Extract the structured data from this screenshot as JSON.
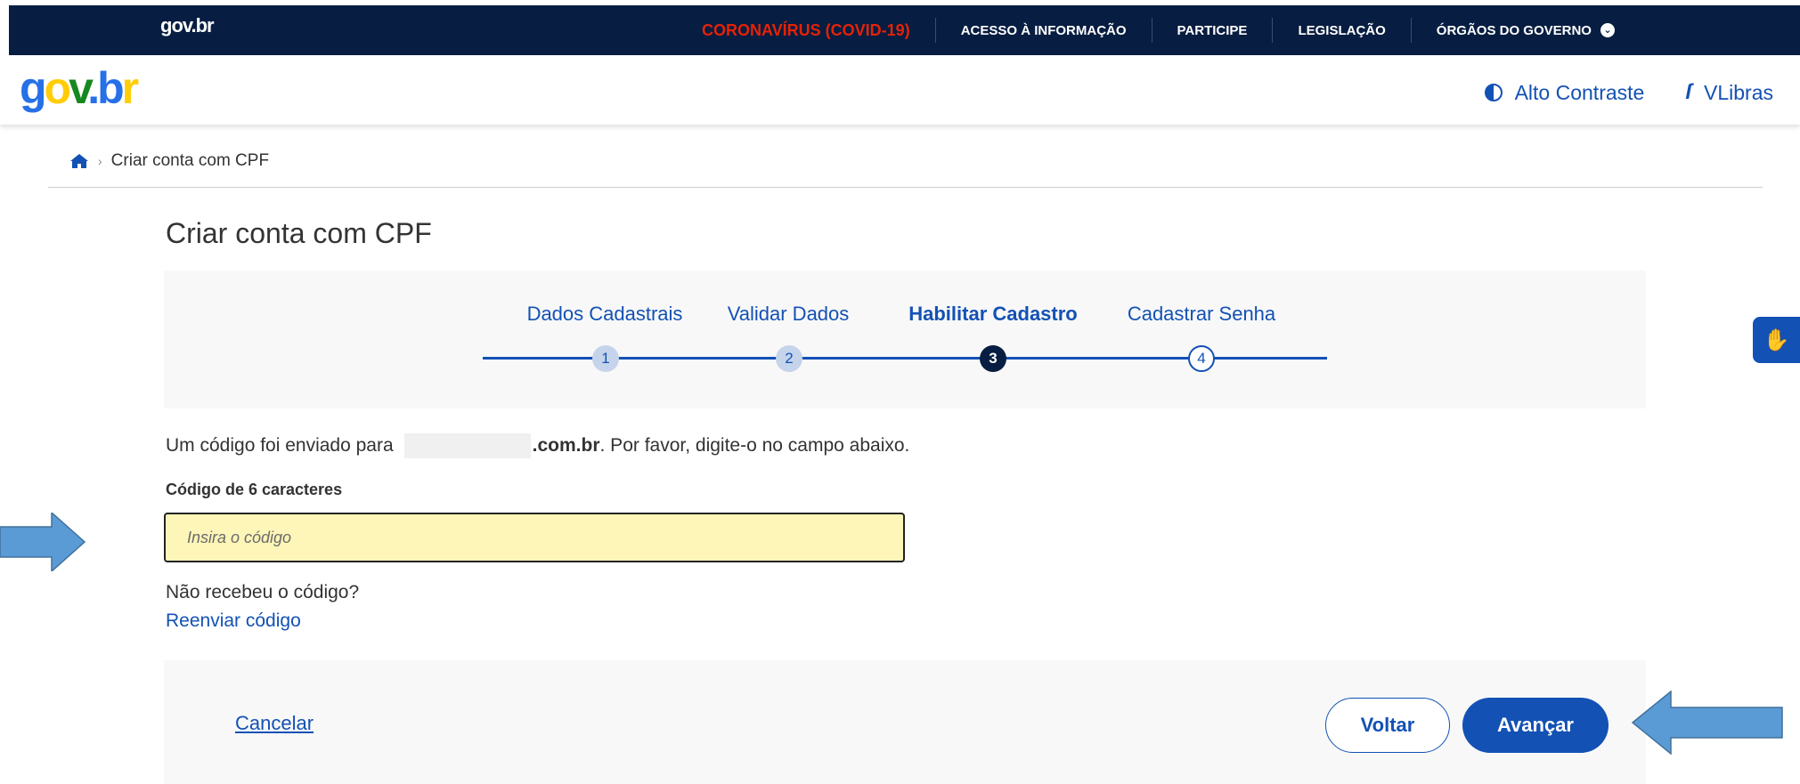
{
  "topbar": {
    "brand": "gov.br",
    "links": [
      {
        "label": "CORONAVÍRUS (COVID-19)"
      },
      {
        "label": "ACESSO À INFORMAÇÃO"
      },
      {
        "label": "PARTICIPE"
      },
      {
        "label": "LEGISLAÇÃO"
      },
      {
        "label": "ÓRGÃOS DO GOVERNO"
      }
    ],
    "colors": {
      "background": "#071d41",
      "covid": "#e52207"
    }
  },
  "header": {
    "logo": "gov.br",
    "contrast_label": "Alto Contraste",
    "vlibras_label": "VLibras",
    "accent_color": "#1351b4"
  },
  "breadcrumb": {
    "home_icon": "home-icon",
    "current": "Criar conta com CPF"
  },
  "main": {
    "title": "Criar conta com CPF",
    "steps": [
      {
        "label": "Dados Cadastrais",
        "number": "1",
        "state": "done"
      },
      {
        "label": "Validar Dados",
        "number": "2",
        "state": "done"
      },
      {
        "label": "Habilitar Cadastro",
        "number": "3",
        "state": "active"
      },
      {
        "label": "Cadastrar Senha",
        "number": "4",
        "state": "todo"
      }
    ],
    "info_prefix": "Um código foi enviado para",
    "info_domain": ".com.br",
    "info_suffix": ". Por favor, digite-o no campo abaixo.",
    "field_label": "Código de 6 caracteres",
    "code_input": {
      "value": "",
      "placeholder": "Insira o código"
    },
    "not_received": "Não recebeu o código?",
    "resend_label": "Reenviar código"
  },
  "actions": {
    "cancel_label": "Cancelar",
    "back_label": "Voltar",
    "next_label": "Avançar"
  },
  "annotations": {
    "arrow_color": "#5b9bd5"
  }
}
